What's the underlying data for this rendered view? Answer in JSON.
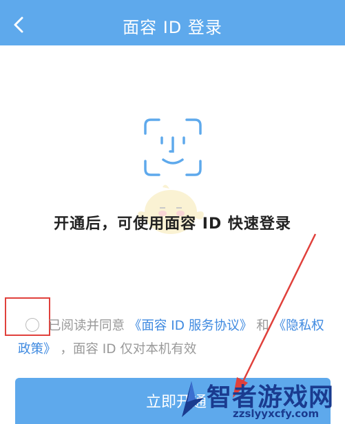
{
  "header": {
    "title": "面容 ID 登录",
    "back_icon": "chevron-left-icon"
  },
  "main": {
    "face_icon": "face-id-icon",
    "intro_text": "开通后，可使用面容 ID 快速登录"
  },
  "agreement": {
    "prefix": "已阅读并同意",
    "service_link": "《面容 ID 服务协议》",
    "and_text": "和",
    "privacy_link": "《隐私权政策》",
    "suffix": "，面容 ID 仅对本机有效",
    "checked": false
  },
  "button": {
    "label": "立即开通"
  },
  "watermark": {
    "brand": "智者游戏网",
    "url": "zzslyyxcfy.com"
  },
  "colors": {
    "header": "#5ea9ec",
    "link": "#3f8ae0",
    "annotation": "#e0403b"
  }
}
